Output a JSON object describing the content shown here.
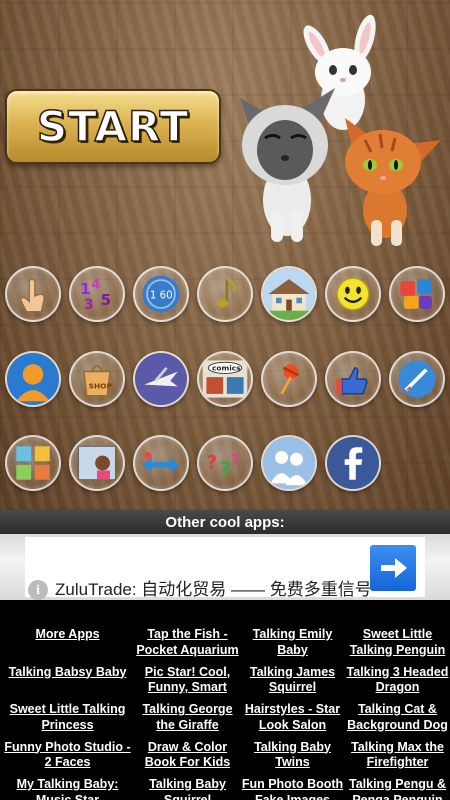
{
  "start_button": {
    "label": "START"
  },
  "characters": [
    {
      "name": "rabbit",
      "icon": "white-rabbit"
    },
    {
      "name": "siamese-cat",
      "icon": "siamese-kitten"
    },
    {
      "name": "orange-cat",
      "icon": "orange-tabby-kitten"
    }
  ],
  "icon_grid": [
    {
      "icon": "finger-icon"
    },
    {
      "icon": "numbers-icon"
    },
    {
      "icon": "counter-icon"
    },
    {
      "icon": "music-note-icon"
    },
    {
      "icon": "house-icon"
    },
    {
      "icon": "smiley-icon"
    },
    {
      "icon": "puzzle-icon"
    },
    {
      "icon": "profile-icon"
    },
    {
      "icon": "shopping-bag-icon"
    },
    {
      "icon": "flying-icon"
    },
    {
      "icon": "comics-icon"
    },
    {
      "icon": "pushpin-icon"
    },
    {
      "icon": "thumbs-up-icon"
    },
    {
      "icon": "paintbrush-icon"
    },
    {
      "icon": "characters-grid-icon"
    },
    {
      "icon": "tablet-kid-icon"
    },
    {
      "icon": "arrows-icon"
    },
    {
      "icon": "question-marks-icon"
    },
    {
      "icon": "people-icon"
    },
    {
      "icon": "facebook-icon"
    }
  ],
  "comics_label": "comics",
  "shop_label": "SHOP",
  "other_apps_label": "Other cool apps:",
  "ad": {
    "text": "ZuluTrade: 自动化贸易 —— 免费多重信号",
    "info_label": "i"
  },
  "app_links": [
    "More Apps",
    "Tap the Fish - Pocket Aquarium",
    "Talking Emily Baby",
    "Sweet Little Talking Penguin",
    "Talking Babsy Baby",
    "Pic Star! Cool, Funny, Smart",
    "Talking James Squirrel",
    "Talking 3 Headed Dragon",
    "Sweet Little Talking Princess",
    "Talking George the Giraffe",
    "Hairstyles - Star Look Salon",
    "Talking Cat & Background Dog",
    "Funny Photo Studio - 2 Faces",
    "Draw & Color Book For Kids",
    "Talking Baby Twins",
    "Talking Max the Firefighter",
    "My Talking Baby: Music Star",
    "Talking Baby Squirrel",
    "Fun Photo Booth Fake Images",
    "Talking Pengu & Penga Penguin"
  ],
  "colors": {
    "start_gold": "#dcb352",
    "ad_arrow_blue": "#1565d8",
    "facebook_blue": "#3b5998"
  }
}
